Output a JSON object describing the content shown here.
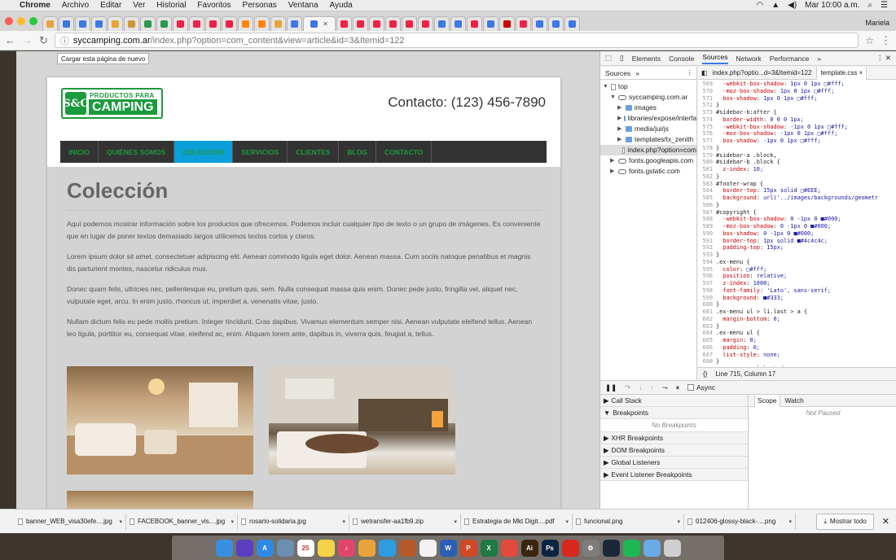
{
  "menubar": {
    "apple": "",
    "items": [
      "Chrome",
      "Archivo",
      "Editar",
      "Ver",
      "Historial",
      "Favoritos",
      "Personas",
      "Ventana",
      "Ayuda"
    ],
    "clock": "Mar 10:00 a.m."
  },
  "tabs": {
    "profile": "Mariela",
    "active_close": "✕",
    "favicon_colors": [
      "#e8a33b",
      "#3b7be0",
      "#3b7be0",
      "#3b7be0",
      "#e8a33b",
      "#c93",
      "#2a9b48",
      "#2a9b48",
      "#e24",
      "#e24",
      "#e24",
      "#e24",
      "#f80",
      "#f80",
      "#e8a33b",
      "#3b7be0",
      "#3b7be0",
      "#e24",
      "#e24",
      "#e24",
      "#e24",
      "#e24",
      "#e24",
      "#3b7be0",
      "#3b7be0",
      "#e24",
      "#3b7be0",
      "#c00",
      "#e24",
      "#3b7be0",
      "#3b7be0",
      "#3b7be0"
    ]
  },
  "omnibar": {
    "url_host": "syccamping.com.ar",
    "url_path": "/index.php?option=com_content&view=article&id=3&Itemid=122",
    "tooltip": "Cargar esta página de nuevo"
  },
  "site": {
    "logo_mark": "S&C",
    "logo_line1": "PRODUCTOS PARA",
    "logo_line2": "CAMPING",
    "contact": "Contacto: (123) 456-7890",
    "menu": [
      "INICIO",
      "QUIÉNES SOMOS",
      "COLECCIÓN",
      "SERVICIOS",
      "CLIENTES",
      "BLOG",
      "CONTACTO"
    ],
    "active_menu_index": 2,
    "title": "Colección",
    "paragraphs": [
      "Aquí podemos mostrar información sobre los productos que ofrecemos. Podemos incluir cualquier tipo de texto o un grupo de imágenes. Es conveniente que en lugar de poner textos demasiado largos utilicemos textos cortos y claros.",
      "Lorem ipsum dolor sit amet, consectetuer adipiscing elit. Aenean commodo ligula eget dolor. Aenean massa. Cum sociis natoque penatibus et magnis dis parturient montes, nascetur ridiculus mus.",
      "Donec quam felis, ultricies nec, pellentesque eu, pretium quis, sem. Nulla consequat massa quis enim. Donec pede justo, fringilla vel, aliquet nec, vulputate eget, arcu. In enim justo, rhoncus ut, imperdiet a, venenatis vitae, justo.",
      "Nullam dictum felis eu pede mollis pretium. Integer tincidunt. Cras dapibus. Vivamus elementum semper nisi. Aenean vulputate eleifend tellus. Aenean leo ligula, porttitor eu, consequat vitae, eleifend ac, enim. Aliquam lorem ante, dapibus in, viverra quis, feugiat a, tellus."
    ]
  },
  "devtools": {
    "tabs": [
      "Elements",
      "Console",
      "Sources",
      "Network",
      "Performance",
      "»"
    ],
    "active_tab": "Sources",
    "sources_header": "Sources",
    "tree": [
      {
        "label": "top",
        "kind": "frame",
        "indent": 0,
        "arrow": "▼"
      },
      {
        "label": "syccamping.com.ar",
        "kind": "cloud",
        "indent": 1,
        "arrow": "▼"
      },
      {
        "label": "images",
        "kind": "folder",
        "indent": 2,
        "arrow": "▶"
      },
      {
        "label": "libraries/expose/interfa",
        "kind": "folder",
        "indent": 2,
        "arrow": "▶"
      },
      {
        "label": "media/jui/js",
        "kind": "folder",
        "indent": 2,
        "arrow": "▶"
      },
      {
        "label": "templates/tx_zenith",
        "kind": "folder",
        "indent": 2,
        "arrow": "▶"
      },
      {
        "label": "index.php?option=com",
        "kind": "file",
        "indent": 2,
        "arrow": ""
      },
      {
        "label": "fonts.googleapis.com",
        "kind": "cloud",
        "indent": 1,
        "arrow": "▶"
      },
      {
        "label": "fonts.gstatic.com",
        "kind": "cloud",
        "indent": 1,
        "arrow": "▶"
      }
    ],
    "editor_tabs": [
      "index.php?optio...d=3&Itemid=122",
      "template.css ×"
    ],
    "code": [
      [
        "569",
        "  -webkit-box-shadow: 1px 0 1px □#fff;"
      ],
      [
        "570",
        "  -moz-box-shadow: 1px 0 1px □#fff;"
      ],
      [
        "571",
        "  box-shadow: 1px 0 1px □#fff;"
      ],
      [
        "572",
        "}"
      ],
      [
        "573",
        "#sidebar-b:after {"
      ],
      [
        "574",
        "  border-width: 0 0 0 1px;"
      ],
      [
        "575",
        "  -webkit-box-shadow: -1px 0 1px □#fff;"
      ],
      [
        "576",
        "  -moz-box-shadow: -1px 0 1px □#fff;"
      ],
      [
        "577",
        "  box-shadow: -1px 0 1px □#fff;"
      ],
      [
        "578",
        "}"
      ],
      [
        "579",
        "#sidebar-a .block,"
      ],
      [
        "580",
        "#sidebar-b .block {"
      ],
      [
        "581",
        "  z-index: 10;"
      ],
      [
        "582",
        "}"
      ],
      [
        "583",
        "#footer-wrap {"
      ],
      [
        "584",
        "  border-top: 15px solid □#EEE;"
      ],
      [
        "585",
        "  background: url('../images/backgrounds/geometr"
      ],
      [
        "586",
        "}"
      ],
      [
        "587",
        "#copyright {"
      ],
      [
        "588",
        "  -webkit-box-shadow: 0 -1px 0 ■#000;"
      ],
      [
        "589",
        "  -moz-box-shadow: 0 -1px 0 ■#000;"
      ],
      [
        "590",
        "  box-shadow: 0 -1px 0 ■#000;"
      ],
      [
        "591",
        "  border-top: 1px solid ■#4c4c4c;"
      ],
      [
        "592",
        "  padding-top: 15px;"
      ],
      [
        "593",
        "}"
      ],
      [
        "594",
        ".ex-menu {"
      ],
      [
        "595",
        "  color: □#fff;"
      ],
      [
        "596",
        "  position: relative;"
      ],
      [
        "597",
        "  z-index: 1000;"
      ],
      [
        "598",
        "  font-family: 'Lato', sans-serif;"
      ],
      [
        "599",
        "  background: ■#333;"
      ],
      [
        "600",
        "}"
      ],
      [
        "601",
        ".ex-menu ul > li.last > a {"
      ],
      [
        "602",
        "  margin-bottom: 0;"
      ],
      [
        "603",
        "}"
      ],
      [
        "604",
        ".ex-menu ul {"
      ],
      [
        "605",
        "  margin: 0;"
      ],
      [
        "606",
        "  padding: 0;"
      ],
      [
        "607",
        "  list-style: none;"
      ],
      [
        "608",
        "}"
      ],
      [
        "609",
        ".ex-menu > ul.l1:before,"
      ],
      [
        "610",
        ""
      ]
    ],
    "status_line": "Line 715, Column 17",
    "status_brace": "{}",
    "async_label": "Async",
    "debug_sections": [
      "Call Stack",
      "Breakpoints",
      "XHR Breakpoints",
      "DOM Breakpoints",
      "Global Listeners",
      "Event Listener Breakpoints"
    ],
    "no_breakpoints": "No Breakpoints",
    "scope_tabs": [
      "Scope",
      "Watch"
    ],
    "not_paused": "Not Paused"
  },
  "downloads": {
    "items": [
      "banner_WEB_visa30efe....jpg",
      "FACEBOOK_banner_vis....jpg",
      "rosario-solidaria.jpg",
      "wetransfer-aa1fb9.zip",
      "Estrategia de Mkt Digit....pdf",
      "funcional.png",
      "012406-glossy-black-....png"
    ],
    "show_all": "Mostrar todo",
    "close": "✕"
  },
  "dock": {
    "apps": [
      {
        "name": "finder",
        "color": "#3b8fe0",
        "glyph": ""
      },
      {
        "name": "siri",
        "color": "#5a3fc0",
        "glyph": ""
      },
      {
        "name": "app-store",
        "color": "#2f8ae6",
        "glyph": "A"
      },
      {
        "name": "preview",
        "color": "#6a8fb0",
        "glyph": ""
      },
      {
        "name": "calendar",
        "color": "#ffffff",
        "glyph": "25"
      },
      {
        "name": "notes",
        "color": "#f5d247",
        "glyph": ""
      },
      {
        "name": "itunes",
        "color": "#e2456b",
        "glyph": "♪"
      },
      {
        "name": "photos",
        "color": "#e8a33b",
        "glyph": ""
      },
      {
        "name": "messages",
        "color": "#2f9be0",
        "glyph": ""
      },
      {
        "name": "gimp",
        "color": "#b45a2a",
        "glyph": ""
      },
      {
        "name": "text-edit",
        "color": "#f2f2f2",
        "glyph": ""
      },
      {
        "name": "word",
        "color": "#2b5fb5",
        "glyph": "W"
      },
      {
        "name": "powerpoint",
        "color": "#d24726",
        "glyph": "P"
      },
      {
        "name": "excel",
        "color": "#1f7a44",
        "glyph": "X"
      },
      {
        "name": "chrome",
        "color": "#e24a3b",
        "glyph": ""
      },
      {
        "name": "illustrator",
        "color": "#3a2510",
        "glyph": "Ai"
      },
      {
        "name": "photoshop",
        "color": "#0b2440",
        "glyph": "Ps"
      },
      {
        "name": "acrobat",
        "color": "#d9281e",
        "glyph": ""
      },
      {
        "name": "system-preferences",
        "color": "#7d7d7d",
        "glyph": "⚙"
      },
      {
        "name": "steam",
        "color": "#1b2838",
        "glyph": ""
      },
      {
        "name": "spotify",
        "color": "#1db954",
        "glyph": ""
      },
      {
        "name": "downloads-folder",
        "color": "#6aaae6",
        "glyph": ""
      },
      {
        "name": "trash",
        "color": "#cfcfcf",
        "glyph": ""
      }
    ]
  }
}
